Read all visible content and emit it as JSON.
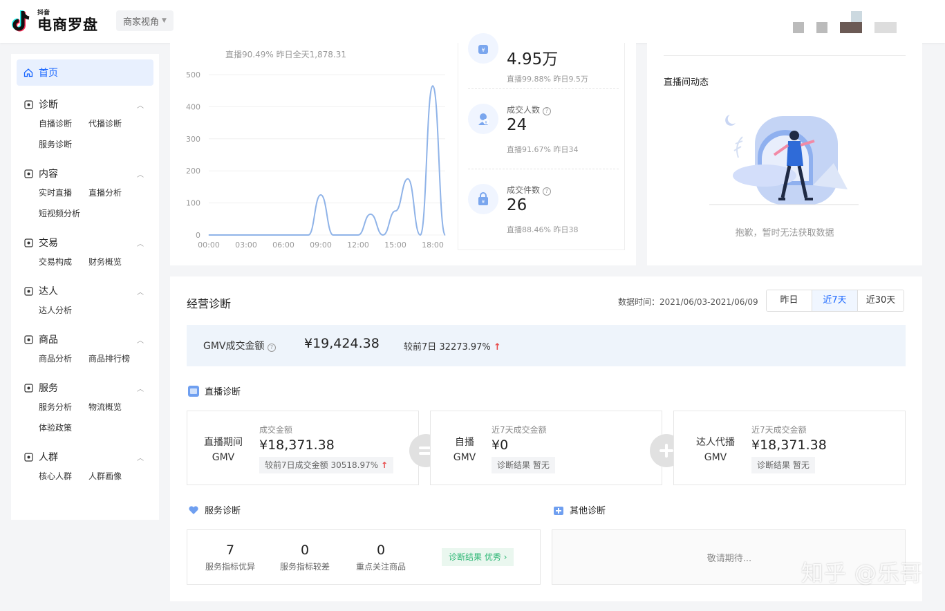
{
  "header": {
    "logo_small": "抖音",
    "logo_big": "电商罗盘",
    "view_select": "商家视角"
  },
  "sidebar": {
    "home": "首页",
    "groups": [
      {
        "label": "诊断",
        "items": [
          "自播诊断",
          "代播诊断",
          "服务诊断"
        ]
      },
      {
        "label": "内容",
        "items": [
          "实时直播",
          "直播分析",
          "短视频分析"
        ]
      },
      {
        "label": "交易",
        "items": [
          "交易构成",
          "财务概览"
        ]
      },
      {
        "label": "达人",
        "items": [
          "达人分析"
        ]
      },
      {
        "label": "商品",
        "items": [
          "商品分析",
          "商品排行榜"
        ]
      },
      {
        "label": "服务",
        "items": [
          "服务分析",
          "物流概览",
          "体验政策"
        ]
      },
      {
        "label": "人群",
        "items": [
          "核心人群",
          "人群画像"
        ]
      }
    ]
  },
  "chart": {
    "subline": "直播90.49%   昨日全天1,878.31"
  },
  "chart_data": {
    "type": "line",
    "x": [
      "00:00",
      "01:00",
      "02:00",
      "03:00",
      "04:00",
      "05:00",
      "06:00",
      "07:00",
      "08:00",
      "09:00",
      "10:00",
      "11:00",
      "12:00",
      "13:00",
      "14:00",
      "15:00",
      "16:00",
      "17:00",
      "18:00",
      "19:00"
    ],
    "xticks": [
      "00:00",
      "03:00",
      "06:00",
      "09:00",
      "12:00",
      "15:00",
      "18:00"
    ],
    "values": [
      0,
      0,
      0,
      0,
      0,
      0,
      0,
      0,
      0,
      125,
      0,
      0,
      0,
      65,
      0,
      75,
      175,
      0,
      465,
      0
    ],
    "yticks": [
      0,
      100,
      200,
      300,
      400,
      500
    ],
    "ylim": [
      0,
      500
    ],
    "color": "#8fb3e8"
  },
  "metrics": [
    {
      "label": "",
      "value": "4.95万",
      "sub": "直播99.88%   昨日9.5万",
      "icon": "money-bag-icon"
    },
    {
      "label": "成交人数",
      "value": "24",
      "sub": "直播91.67%   昨日34",
      "icon": "buyer-icon"
    },
    {
      "label": "成交件数",
      "value": "26",
      "sub": "直播88.46%   昨日38",
      "icon": "shopping-bag-icon"
    }
  ],
  "live_room": {
    "title": "直播间动态",
    "empty_text": "抱歉，暂时无法获取数据"
  },
  "diagnosis": {
    "title": "经营诊断",
    "data_time_label": "数据时间：",
    "data_time": "2021/06/03-2021/06/09",
    "ranges": [
      "昨日",
      "近7天",
      "近30天"
    ],
    "active_range": "近7天",
    "gmv_label": "GMV成交金额",
    "gmv_value": "¥19,424.38",
    "gmv_compare": "较前7日 32273.97%",
    "live_section": "直播诊断",
    "flows": [
      {
        "left1": "直播期间",
        "left2": "GMV",
        "label": "成交金额",
        "value": "¥18,371.38",
        "tag": "较前7日成交金额 30518.97%"
      },
      {
        "left1": "自播",
        "left2": "GMV",
        "label": "近7天成交金额",
        "value": "¥0",
        "tag": "诊断结果 暂无"
      },
      {
        "left1": "达人代播",
        "left2": "GMV",
        "label": "近7天成交金额",
        "value": "¥18,371.38",
        "tag": "诊断结果 暂无"
      }
    ],
    "service_section": "服务诊断",
    "service_items": [
      {
        "num": "7",
        "label": "服务指标优异"
      },
      {
        "num": "0",
        "label": "服务指标较差"
      },
      {
        "num": "0",
        "label": "重点关注商品"
      }
    ],
    "service_badge": "诊断结果 优秀",
    "other_section": "其他诊断",
    "other_text": "敬请期待..."
  },
  "watermark": "知乎 @乐哥"
}
